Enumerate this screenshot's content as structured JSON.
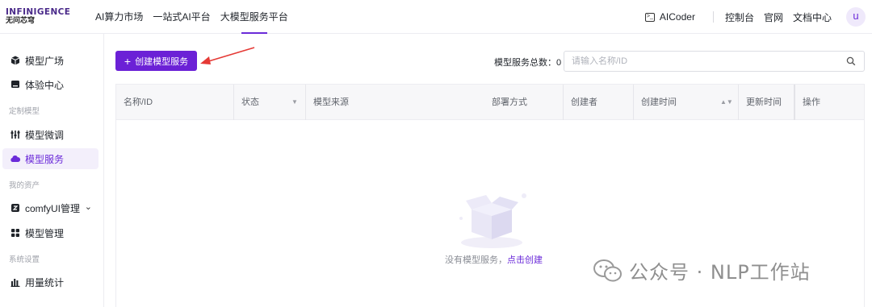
{
  "header": {
    "logo_brand": "INFINIGENCE",
    "logo_sub": "无问芯穹",
    "nav": [
      "AI算力市场",
      "一站式AI平台",
      "大模型服务平台"
    ],
    "active_nav": "大模型服务平台",
    "aicoder_label": "AICoder",
    "links": [
      "控制台",
      "官网",
      "文档中心"
    ],
    "user_initial": "u"
  },
  "sidebar": {
    "items": [
      {
        "label": "模型广场",
        "icon": "cube-icon"
      },
      {
        "label": "体验中心",
        "icon": "chat-icon"
      },
      {
        "group": "定制模型"
      },
      {
        "label": "模型微调",
        "icon": "sliders-icon"
      },
      {
        "label": "模型服务",
        "icon": "cloud-icon",
        "active": true
      },
      {
        "group": "我的资产"
      },
      {
        "label": "comfyUI管理",
        "icon": "flow-icon",
        "has_submenu": true
      },
      {
        "label": "模型管理",
        "icon": "grid-icon"
      },
      {
        "group": "系统设置"
      },
      {
        "label": "用量统计",
        "icon": "bar-chart-icon"
      }
    ]
  },
  "toolbar": {
    "create_label": "创建模型服务",
    "count_label": "模型服务总数：",
    "count_value": "0",
    "search_placeholder": "请输入名称/ID"
  },
  "table": {
    "columns": [
      "名称/ID",
      "状态",
      "模型来源",
      "部署方式",
      "创建者",
      "创建时间",
      "更新时间",
      "操作"
    ]
  },
  "empty": {
    "text": "没有模型服务，",
    "link": "点击创建"
  },
  "watermark": "公众号 · NLP工作站",
  "colors": {
    "accent": "#6b21d6",
    "annotation_arrow": "#e53935"
  }
}
